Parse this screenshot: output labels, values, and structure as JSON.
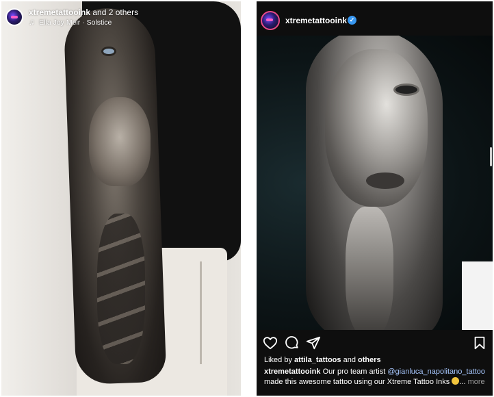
{
  "left_story": {
    "account_name": "xtremetattooink",
    "collab_text": "and 2 others",
    "music": "Ella Joy Meir · Solstice",
    "music_icon": "music-note-icon"
  },
  "right_post": {
    "username": "xtremetattooink",
    "verified_icon": "verified-badge-icon",
    "actions": [
      "like-icon",
      "comment-icon",
      "share-icon",
      "save-icon"
    ],
    "likes": {
      "prefix": "Liked by",
      "user": "attila_tattoos",
      "middle": "and",
      "suffix": "others"
    },
    "caption": {
      "username": "xtremetattooink",
      "text_1": "Our pro team artist",
      "mention": "@gianluca_napolitano_tattoo",
      "text_2": "made this awesome tattoo using our Xtreme Tattoo Inks",
      "emoji_icon": "grinning-face-icon",
      "ellipsis": "...",
      "more": "more"
    }
  },
  "colors": {
    "background_dark": "#0e0e0e",
    "verified_blue": "#3897f0",
    "mention": "#a8c8ff",
    "muted": "#9a9a9a"
  }
}
